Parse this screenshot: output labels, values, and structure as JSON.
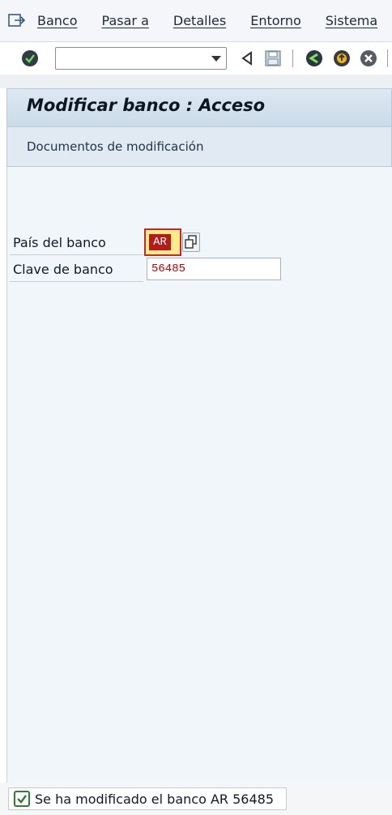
{
  "menubar": {
    "icon": "menu-exit-icon",
    "items": [
      {
        "label": "Banco"
      },
      {
        "label": "Pasar a"
      },
      {
        "label": "Detalles"
      },
      {
        "label": "Entorno"
      },
      {
        "label": "Sistema"
      }
    ]
  },
  "toolbar": {
    "command_field_value": "",
    "icons": [
      "enter-check-icon",
      "dropdown-icon",
      "back-triangle-icon",
      "save-icon",
      "back-icon",
      "exit-icon",
      "cancel-icon"
    ]
  },
  "title": "Modificar banco : Acceso",
  "app_toolbar": {
    "button_label": "Documentos de modificación"
  },
  "form": {
    "country_label": "País del banco",
    "country_value": "AR",
    "key_label": "Clave de banco",
    "key_value": "56485"
  },
  "status": {
    "message": "Se ha modificado el banco AR 56485",
    "type": "success"
  },
  "colors": {
    "accent": "#cbdbe9",
    "success": "#2e7d32",
    "required": "#c62828"
  }
}
